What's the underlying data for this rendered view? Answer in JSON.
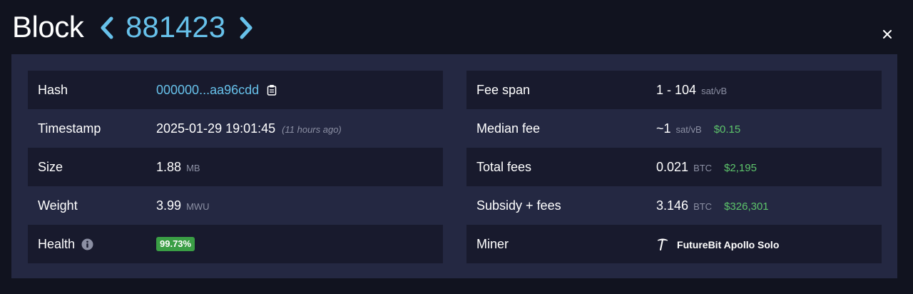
{
  "header": {
    "title": "Block",
    "block_number": "881423"
  },
  "details_left": [
    {
      "label": "Hash",
      "value": "000000...aa96cdd"
    },
    {
      "label": "Timestamp",
      "value": "2025-01-29 19:01:45",
      "note": "(11 hours ago)"
    },
    {
      "label": "Size",
      "value": "1.88",
      "unit": "MB"
    },
    {
      "label": "Weight",
      "value": "3.99",
      "unit": "MWU"
    },
    {
      "label": "Health",
      "value": "99.73%"
    }
  ],
  "details_right": [
    {
      "label": "Fee span",
      "value": "1 - 104",
      "unit": "sat/vB"
    },
    {
      "label": "Median fee",
      "value": "~1",
      "unit": "sat/vB",
      "usd": "$0.15"
    },
    {
      "label": "Total fees",
      "value": "0.021",
      "unit": "BTC",
      "usd": "$2,195"
    },
    {
      "label": "Subsidy + fees",
      "value": "3.146",
      "unit": "BTC",
      "usd": "$326,301"
    },
    {
      "label": "Miner",
      "value": "FutureBit Apollo Solo"
    }
  ],
  "icons": {
    "prev": "chevron-left-icon",
    "next": "chevron-right-icon",
    "close": "close-icon",
    "copy": "clipboard-icon",
    "info": "info-icon",
    "miner": "pickaxe-icon"
  },
  "colors": {
    "accent": "#67c1ea",
    "usd": "#5dc46b",
    "health_badge": "#3a9e45",
    "panel": "#242842",
    "row_dark": "#181a2d",
    "background": "#11131f"
  }
}
